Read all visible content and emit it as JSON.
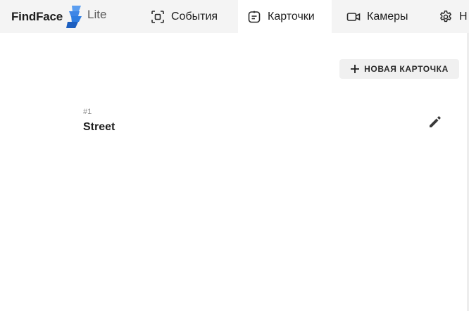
{
  "header": {
    "brand": "FindFace",
    "brand_suffix": "Lite",
    "accent_color": "#2f7de1",
    "tabs": [
      {
        "label": "События",
        "icon": "events-scan-icon",
        "active": false
      },
      {
        "label": "Карточки",
        "icon": "cards-icon",
        "active": true
      },
      {
        "label": "Камеры",
        "icon": "camera-icon",
        "active": false
      },
      {
        "label": "Н",
        "icon": "gear-icon",
        "active": false
      }
    ]
  },
  "toolbar": {
    "new_card_label": "НОВАЯ КАРТОЧКА",
    "new_card_icon": "plus-icon"
  },
  "cards": [
    {
      "id": "#1",
      "name": "Street",
      "action_icon": "pencil-icon"
    }
  ]
}
